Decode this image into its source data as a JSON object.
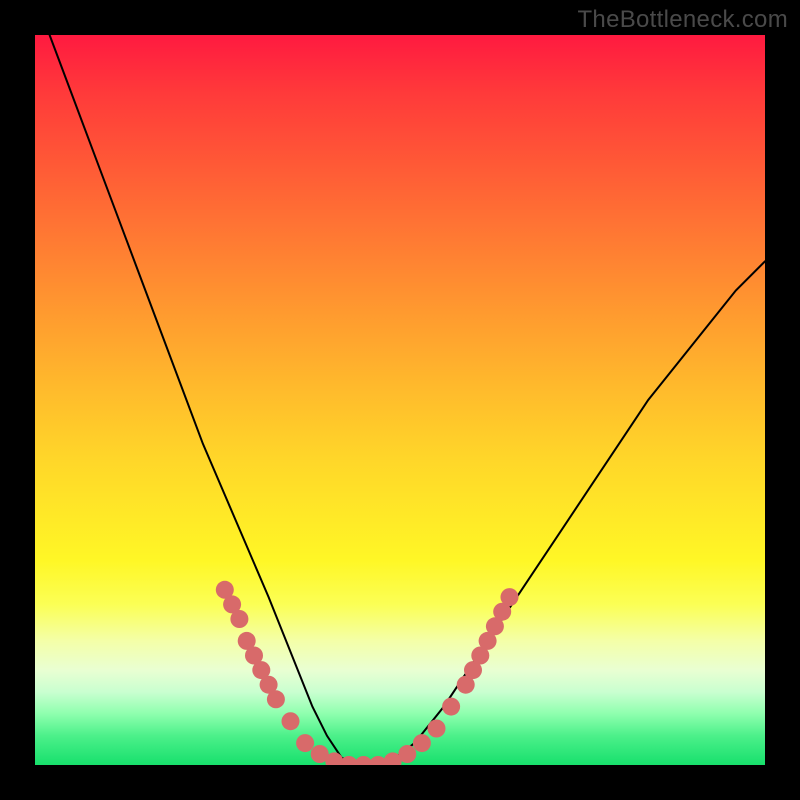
{
  "watermark": "TheBottleneck.com",
  "chart_data": {
    "type": "line",
    "title": "",
    "xlabel": "",
    "ylabel": "",
    "xlim": [
      0,
      100
    ],
    "ylim": [
      0,
      100
    ],
    "series": [
      {
        "name": "bottleneck-curve",
        "x": [
          2,
          5,
          8,
          11,
          14,
          17,
          20,
          23,
          26,
          29,
          32,
          34,
          36,
          38,
          40,
          42,
          44,
          48,
          52,
          56,
          60,
          64,
          68,
          72,
          76,
          80,
          84,
          88,
          92,
          96,
          100
        ],
        "y": [
          100,
          92,
          84,
          76,
          68,
          60,
          52,
          44,
          37,
          30,
          23,
          18,
          13,
          8,
          4,
          1,
          0,
          0,
          3,
          8,
          14,
          20,
          26,
          32,
          38,
          44,
          50,
          55,
          60,
          65,
          69
        ]
      }
    ],
    "markers": {
      "name": "highlight-dots",
      "color": "#d86a6a",
      "points": [
        {
          "x": 26,
          "y": 24
        },
        {
          "x": 27,
          "y": 22
        },
        {
          "x": 28,
          "y": 20
        },
        {
          "x": 29,
          "y": 17
        },
        {
          "x": 30,
          "y": 15
        },
        {
          "x": 31,
          "y": 13
        },
        {
          "x": 32,
          "y": 11
        },
        {
          "x": 33,
          "y": 9
        },
        {
          "x": 35,
          "y": 6
        },
        {
          "x": 37,
          "y": 3
        },
        {
          "x": 39,
          "y": 1.5
        },
        {
          "x": 41,
          "y": 0.5
        },
        {
          "x": 43,
          "y": 0
        },
        {
          "x": 45,
          "y": 0
        },
        {
          "x": 47,
          "y": 0
        },
        {
          "x": 49,
          "y": 0.5
        },
        {
          "x": 51,
          "y": 1.5
        },
        {
          "x": 53,
          "y": 3
        },
        {
          "x": 55,
          "y": 5
        },
        {
          "x": 57,
          "y": 8
        },
        {
          "x": 59,
          "y": 11
        },
        {
          "x": 60,
          "y": 13
        },
        {
          "x": 61,
          "y": 15
        },
        {
          "x": 62,
          "y": 17
        },
        {
          "x": 63,
          "y": 19
        },
        {
          "x": 64,
          "y": 21
        },
        {
          "x": 65,
          "y": 23
        }
      ]
    },
    "gradient_bands": [
      {
        "color": "#ff1a40",
        "stop": 0
      },
      {
        "color": "#ffb92c",
        "stop": 50
      },
      {
        "color": "#fff726",
        "stop": 72
      },
      {
        "color": "#17e06c",
        "stop": 100
      }
    ]
  }
}
